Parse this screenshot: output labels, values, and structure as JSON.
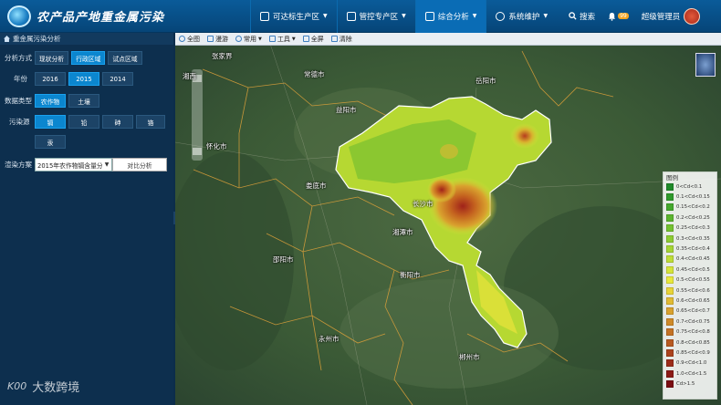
{
  "app": {
    "title": "农产品产地重金属污染"
  },
  "nav": {
    "items": [
      {
        "label": "可达标生产区"
      },
      {
        "label": "管控专产区"
      },
      {
        "label": "综合分析"
      },
      {
        "label": "系统维护"
      }
    ],
    "search": "搜索",
    "badge": "99",
    "user": "超级管理员"
  },
  "sidebar": {
    "title": "重金属污染分析",
    "method": {
      "label": "分析方式",
      "options": [
        "现状分析",
        "行政区域",
        "试点区域"
      ],
      "selected": 1
    },
    "year": {
      "label": "年份",
      "options": [
        "2016",
        "2015",
        "2014"
      ],
      "selected": 1
    },
    "data_type": {
      "label": "数据类型",
      "options": [
        "农作物",
        "土壤"
      ],
      "selected": 0
    },
    "pollutant": {
      "label": "污染源",
      "options": [
        "镉",
        "铅",
        "砷",
        "铬",
        "汞"
      ],
      "selected": 0
    },
    "scheme": {
      "label": "渲染方案",
      "value": "2015年农作物镉含量分",
      "compare": "对比分析"
    }
  },
  "toolbar": {
    "items": [
      "全图",
      "漫游",
      "常用",
      "工具",
      "全屏",
      "清除"
    ]
  },
  "map": {
    "cities": [
      "湘西",
      "张家界",
      "常德市",
      "岳阳市",
      "益阳市",
      "怀化市",
      "娄底市",
      "长沙市",
      "湘潭市",
      "邵阳市",
      "衡阳市",
      "永州市",
      "郴州市"
    ],
    "legend_title": "图例",
    "legend": [
      {
        "label": "0<Cd<0.1",
        "color": "#1f8a2a"
      },
      {
        "label": "0.1<Cd<0.15",
        "color": "#2f9a2c"
      },
      {
        "label": "0.15<Cd<0.2",
        "color": "#44a82d"
      },
      {
        "label": "0.2<Cd<0.25",
        "color": "#5cb52f"
      },
      {
        "label": "0.25<Cd<0.3",
        "color": "#74c231"
      },
      {
        "label": "0.3<Cd<0.35",
        "color": "#8dcc33"
      },
      {
        "label": "0.35<Cd<0.4",
        "color": "#a5d535"
      },
      {
        "label": "0.4<Cd<0.45",
        "color": "#bedd38"
      },
      {
        "label": "0.45<Cd<0.5",
        "color": "#d5e43a"
      },
      {
        "label": "0.5<Cd<0.55",
        "color": "#e8e83c"
      },
      {
        "label": "0.55<Cd<0.6",
        "color": "#e8d438"
      },
      {
        "label": "0.6<Cd<0.65",
        "color": "#e1bb33"
      },
      {
        "label": "0.65<Cd<0.7",
        "color": "#d9a22e"
      },
      {
        "label": "0.7<Cd<0.75",
        "color": "#cf8a29"
      },
      {
        "label": "0.75<Cd<0.8",
        "color": "#c47225"
      },
      {
        "label": "0.8<Cd<0.85",
        "color": "#b85a21"
      },
      {
        "label": "0.85<Cd<0.9",
        "color": "#ab431d"
      },
      {
        "label": "0.9<Cd<1.0",
        "color": "#9c2c1a"
      },
      {
        "label": "1.0<Cd<1.5",
        "color": "#8b1a16"
      },
      {
        "label": "Cd>1.5",
        "color": "#7a0d12"
      }
    ]
  },
  "watermark": {
    "logo": "K00",
    "text": "大数跨境"
  }
}
